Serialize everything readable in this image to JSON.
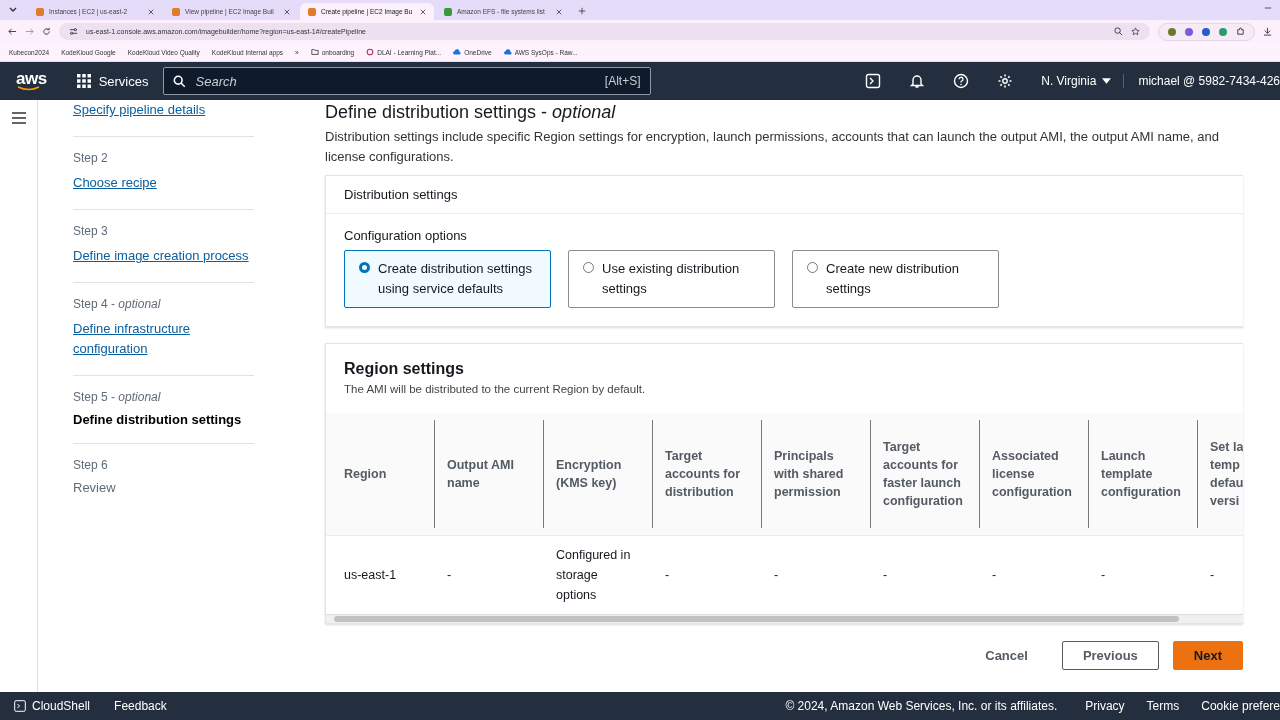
{
  "browser": {
    "tabs": [
      {
        "title": "Instances | EC2 | us-east-2",
        "selected": false,
        "color": "#e07b2a"
      },
      {
        "title": "View pipeline | EC2 Image Buil",
        "selected": false,
        "color": "#e07b2a"
      },
      {
        "title": "Create pipeline | EC2 Image Bu",
        "selected": true,
        "color": "#e07b2a"
      },
      {
        "title": "Amazon EFS - file systems list",
        "selected": false,
        "color": "#3a9a3a"
      }
    ],
    "url": "us-east-1.console.aws.amazon.com/imagebuilder/home?region=us-east-1#/createPipeline",
    "bookmarks": [
      {
        "label": "Kubecon2024",
        "kind": "text"
      },
      {
        "label": "KodeKloud Google",
        "kind": "text"
      },
      {
        "label": "KodeKloud Video Quality",
        "kind": "text"
      },
      {
        "label": "KodeKloud Internal apps",
        "kind": "text"
      },
      {
        "label": "»",
        "kind": "more"
      },
      {
        "label": "onboarding",
        "kind": "folder"
      },
      {
        "label": "DLAI - Learning Plat...",
        "kind": "site"
      },
      {
        "label": "OneDrive",
        "kind": "cloud"
      },
      {
        "label": "AWS SysOps - Raw...",
        "kind": "cloud"
      }
    ]
  },
  "console_nav": {
    "logo": "aws",
    "services": "Services",
    "search_placeholder": "Search",
    "search_shortcut": "[Alt+S]",
    "region": "N. Virginia",
    "account": "michael @ 5982-7434-426"
  },
  "steps": [
    {
      "title": "Specify pipeline details",
      "selected": false,
      "reachable": true
    },
    {
      "label": "Step 2",
      "title": "Choose recipe",
      "selected": false,
      "reachable": true
    },
    {
      "label": "Step 3",
      "title": "Define image creation process",
      "selected": false,
      "reachable": true
    },
    {
      "label": "Step 4 - *optional*",
      "title": "Define infrastructure configuration",
      "selected": false,
      "reachable": true
    },
    {
      "label": "Step 5 - *optional*",
      "title": "Define distribution settings",
      "selected": true,
      "reachable": false
    },
    {
      "label": "Step 6",
      "title": "Review",
      "selected": false,
      "reachable": false
    }
  ],
  "page": {
    "heading": "Define distribution settings - *optional*",
    "description": "Distribution settings include specific Region settings for encryption, launch permissions, accounts that can launch the output AMI, the output AMI name, and license configurations."
  },
  "distribution": {
    "title": "Distribution settings",
    "options_label": "Configuration options",
    "options": [
      {
        "label": "Create distribution settings using service defaults",
        "selected": true
      },
      {
        "label": "Use existing distribution settings",
        "selected": false
      },
      {
        "label": "Create new distribution settings",
        "selected": false
      }
    ]
  },
  "region_settings": {
    "title": "Region settings",
    "description": "The AMI will be distributed to the current Region by default.",
    "table": {
      "columns": [
        "Region",
        "Output AMI name",
        "Encryption (KMS key)",
        "Target accounts for distribution",
        "Principals with shared permission",
        "Target accounts for faster launch configuration",
        "Associated license configuration",
        "Launch template configuration",
        "Set la temp defau versi"
      ],
      "rows": [
        [
          "us-east-1",
          "-",
          "Configured in storage options",
          "-",
          "-",
          "-",
          "-",
          "-",
          "-"
        ]
      ]
    }
  },
  "actions": [
    {
      "label": "Cancel",
      "kind": "link"
    },
    {
      "label": "Previous",
      "kind": "normal"
    },
    {
      "label": "Next",
      "kind": "primary"
    }
  ],
  "footer": {
    "left": [
      "CloudShell",
      "Feedback"
    ],
    "copyright": "© 2024, Amazon Web Services, Inc. or its affiliates.",
    "links": [
      "Privacy",
      "Terms",
      "Cookie prefere"
    ]
  }
}
